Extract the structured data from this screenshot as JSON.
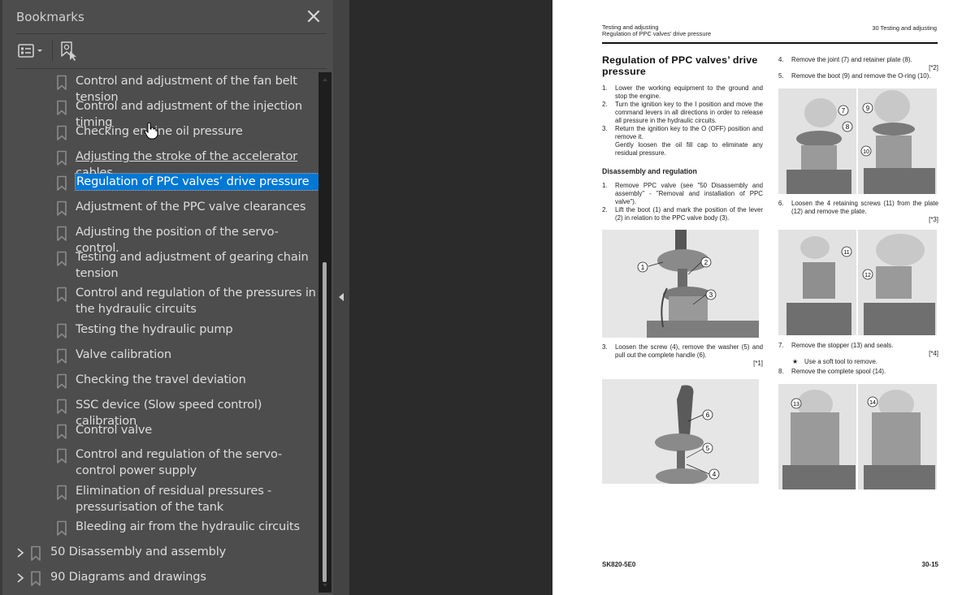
{
  "panel": {
    "title": "Bookmarks",
    "close_icon": "close-icon",
    "toolbar": {
      "options_icon": "list-options-icon",
      "options_caret": "caret-down-icon",
      "find_icon": "find-current-bookmark-icon"
    }
  },
  "bookmarks": [
    {
      "label": "Control and adjustment of the fan belt tension",
      "level": 2,
      "selected": false,
      "underline": false
    },
    {
      "label": "Control and adjustment of the injection timing",
      "level": 2,
      "selected": false,
      "underline": false
    },
    {
      "label": "Checking engine oil pressure",
      "level": 2,
      "selected": false,
      "underline": false
    },
    {
      "label": "Adjusting the stroke of the accelerator cables",
      "level": 2,
      "selected": false,
      "underline": true
    },
    {
      "label": "Regulation of PPC valves’ drive pressure",
      "level": 2,
      "selected": true,
      "underline": false
    },
    {
      "label": "Adjustment of the PPC valve clearances",
      "level": 2,
      "selected": false,
      "underline": false
    },
    {
      "label": "Adjusting the position of the servo-control.",
      "level": 2,
      "selected": false,
      "underline": false
    },
    {
      "label": "Testing and adjustment of gearing chain tension",
      "level": 2,
      "selected": false,
      "underline": false
    },
    {
      "label": "Control and regulation of the pressures in the hydraulic circuits",
      "level": 2,
      "selected": false,
      "underline": false
    },
    {
      "label": "Testing the hydraulic pump",
      "level": 2,
      "selected": false,
      "underline": false
    },
    {
      "label": "Valve calibration",
      "level": 2,
      "selected": false,
      "underline": false
    },
    {
      "label": "Checking the travel deviation",
      "level": 2,
      "selected": false,
      "underline": false
    },
    {
      "label": "SSC device (Slow speed control) calibration",
      "level": 2,
      "selected": false,
      "underline": false
    },
    {
      "label": "Control valve",
      "level": 2,
      "selected": false,
      "underline": false
    },
    {
      "label": "Control and regulation of the servo-control power supply",
      "level": 2,
      "selected": false,
      "underline": false
    },
    {
      "label": "Elimination of residual pressures - pressurisation of the tank",
      "level": 2,
      "selected": false,
      "underline": false
    },
    {
      "label": "Bleeding air from the hydraulic circuits",
      "level": 2,
      "selected": false,
      "underline": false
    },
    {
      "label": "50 Disassembly and assembly",
      "level": 1,
      "selected": false,
      "underline": false,
      "expandable": true
    },
    {
      "label": "90 Diagrams and drawings",
      "level": 1,
      "selected": false,
      "underline": false,
      "expandable": true
    }
  ],
  "page": {
    "header": {
      "left_line1": "Testing and adjusting",
      "left_line2": "Regulation of PPC valves’ drive pressure",
      "right": "30 Testing and adjusting"
    },
    "title": "Regulation of PPC valves’ drive pressure",
    "intro_steps": [
      {
        "num": "1.",
        "text": "Lower the working equipment to the ground and stop the engine."
      },
      {
        "num": "2.",
        "text": "Turn the ignition key to the I position and move the command levers in all directions in order to release all pressure in the hydraulic circuits."
      },
      {
        "num": "3.",
        "text": "Return the ignition key to the O (OFF) position and remove it."
      }
    ],
    "intro_note": "Gently loosen the oil fill cap to eliminate any residual pressure.",
    "subheading": "Disassembly and regulation",
    "steps_left": [
      {
        "num": "1.",
        "text": "Remove PPC valve (see \"50 Disassembly and assembly\" - \"Removal and installation of PPC valve\")."
      },
      {
        "num": "2.",
        "text": "Lift the boot (1) and mark the position of the lever (2) in relation to the PPC valve body (3)."
      }
    ],
    "step3": {
      "num": "3.",
      "text": "Loosen the screw (4), remove the washer (5) and pull out the complete handle (6).",
      "ref": "[*1]"
    },
    "step4": {
      "num": "4.",
      "text": "Remove the joint (7) and retainer plate (8).",
      "ref": "[*2]"
    },
    "step5": {
      "num": "5.",
      "text": "Remove the boot (9) and remove the O-ring (10)."
    },
    "step6": {
      "num": "6.",
      "text": "Loosen the 4 retaining screws (11) from the plate (12) and remove the plate.",
      "ref": "[*3]"
    },
    "step7": {
      "num": "7.",
      "text": "Remove the stopper (13) and seals.",
      "ref": "[*4]"
    },
    "step7_note": {
      "symbol": "★",
      "text": "Use a soft tool to remove."
    },
    "step8": {
      "num": "8.",
      "text": "Remove the complete spool (14)."
    },
    "figures": {
      "fig1_callouts": [
        "1",
        "2",
        "3"
      ],
      "fig2_callouts": [
        "6",
        "5",
        "4"
      ],
      "fig3_callouts": [
        "7",
        "8",
        "9",
        "10"
      ],
      "fig4_callouts": [
        "11",
        "12"
      ],
      "fig5_callouts": [
        "13",
        "14"
      ]
    },
    "footer": {
      "left": "SK820-5E0",
      "right": "30-15"
    }
  }
}
